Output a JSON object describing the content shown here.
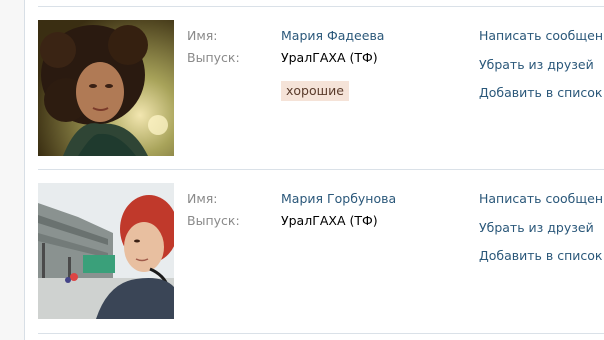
{
  "friends": [
    {
      "name_label": "Имя:",
      "name": "Мария Фадеева",
      "grad_label": "Выпуск:",
      "grad": "УралГАХА (ТФ)",
      "tag": "хорошие",
      "actions": [
        "Написать сообщение",
        "Убрать из друзей",
        "Добавить в список"
      ]
    },
    {
      "name_label": "Имя:",
      "name": "Мария Горбунова",
      "grad_label": "Выпуск:",
      "grad": "УралГАХА (ТФ)",
      "actions": [
        "Написать сообщение",
        "Убрать из друзей",
        "Добавить в список"
      ]
    }
  ],
  "colors": {
    "link": "#2b587a",
    "label": "#8a8a8a",
    "tag_bg": "#f5e3d8",
    "separator": "#dae1e8"
  }
}
